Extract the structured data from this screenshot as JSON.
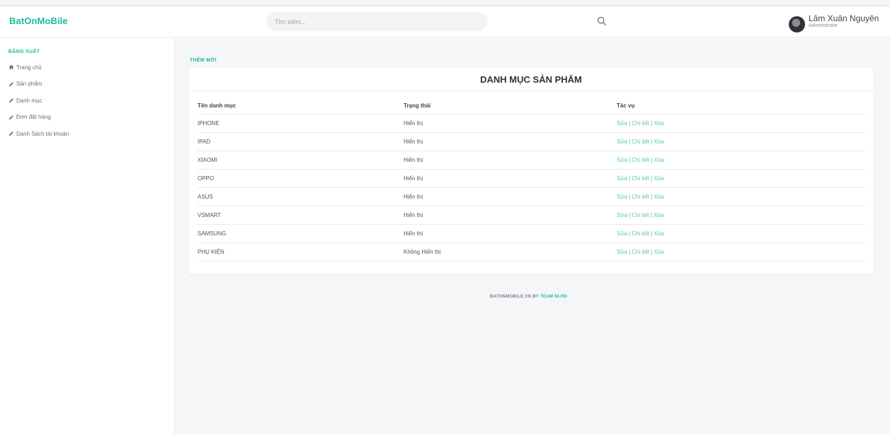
{
  "brand": "BatOnMoBile",
  "search": {
    "placeholder": "Tìm kiếm..."
  },
  "user": {
    "name": "Lâm Xuân Nguyên",
    "role": "Administrator"
  },
  "sidebar": {
    "logout": "ĐĂNG XUẤT",
    "items": [
      {
        "label": "Trang chủ",
        "icon": "home-icon"
      },
      {
        "label": "Sản phẩm",
        "icon": "pencil-icon"
      },
      {
        "label": "Danh mục",
        "icon": "pencil-icon"
      },
      {
        "label": "Đơn đặt hàng",
        "icon": "pencil-icon"
      },
      {
        "label": "Danh Sách tài khoản",
        "icon": "pencil-icon"
      }
    ]
  },
  "main": {
    "add_label": "THÊM MỚI",
    "title": "DANH MỤC SẢN PHẨM",
    "columns": [
      "Tên danh mục",
      "Trạng thái",
      "Tác vụ"
    ],
    "actions": {
      "edit": "Sửa",
      "detail": "Chi tiết",
      "delete": "Xóa",
      "separator": "|"
    },
    "rows": [
      {
        "name": "IPHONE",
        "status": "Hiển thị"
      },
      {
        "name": "IPAD",
        "status": "Hiển thị"
      },
      {
        "name": "XIAOMI",
        "status": "Hiển thị"
      },
      {
        "name": "OPPO",
        "status": "Hiển thị"
      },
      {
        "name": "ASUS",
        "status": "Hiển thị"
      },
      {
        "name": "VSMART",
        "status": "Hiển thị"
      },
      {
        "name": "SAMSUNG",
        "status": "Hiển thị"
      },
      {
        "name": "PHỤ KIỆN",
        "status": "Không Hiển thị"
      }
    ]
  },
  "footer": {
    "text": "BATONMOBILE.VN BY",
    "team": "TEAM NLHD"
  },
  "colors": {
    "accent": "#1abc9c",
    "action_link": "#52c7c0",
    "background": "#f5f6f8"
  }
}
